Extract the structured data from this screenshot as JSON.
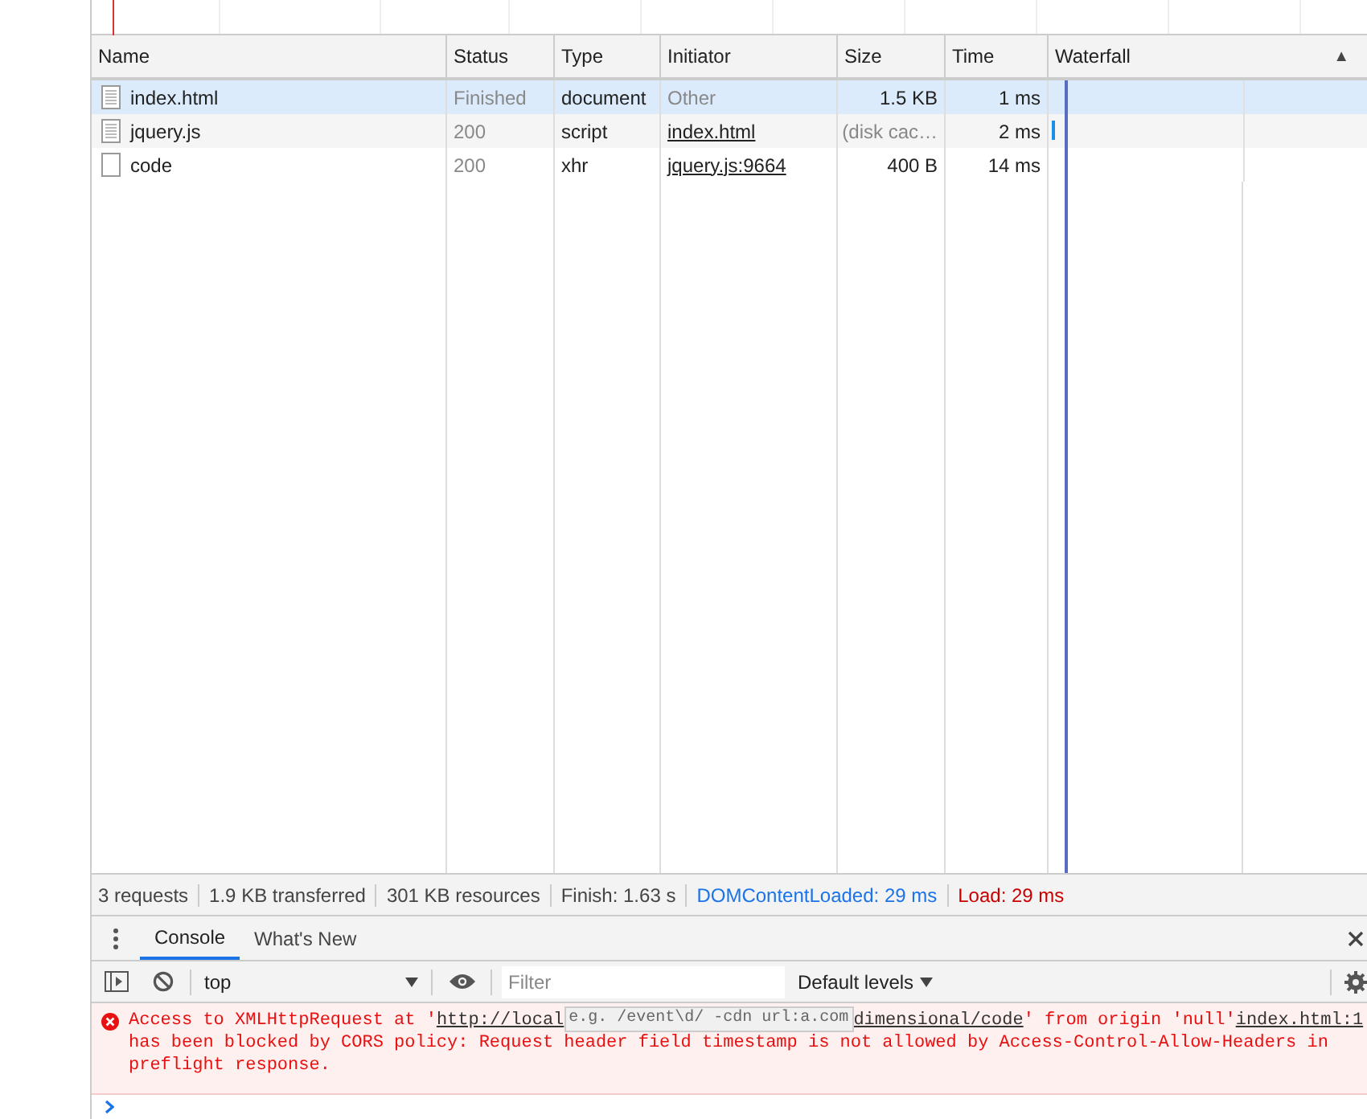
{
  "columns": [
    "Name",
    "Status",
    "Type",
    "Initiator",
    "Size",
    "Time",
    "Waterfall"
  ],
  "sort_indicator": "▲",
  "rows": [
    {
      "name": "index.html",
      "status": "Finished",
      "type": "document",
      "initiator": "Other",
      "initiator_link": false,
      "size": "1.5 KB",
      "time": "1 ms",
      "selected": true,
      "kind": "doc"
    },
    {
      "name": "jquery.js",
      "status": "200",
      "type": "script",
      "initiator": "index.html",
      "initiator_link": true,
      "size": "(disk cac…",
      "time": "2 ms",
      "selected": false,
      "kind": "doc"
    },
    {
      "name": "code",
      "status": "200",
      "type": "xhr",
      "initiator": "jquery.js:9664",
      "initiator_link": true,
      "size": "400 B",
      "time": "14 ms",
      "selected": false,
      "kind": "blank"
    }
  ],
  "summary": [
    {
      "text": "3 requests",
      "kind": "plain"
    },
    {
      "text": "1.9 KB transferred",
      "kind": "plain"
    },
    {
      "text": "301 KB resources",
      "kind": "plain"
    },
    {
      "text": "Finish: 1.63 s",
      "kind": "plain"
    },
    {
      "text": "DOMContentLoaded: 29 ms",
      "kind": "dcl"
    },
    {
      "text": "Load: 29 ms",
      "kind": "load"
    }
  ],
  "drawer_tabs": [
    {
      "label": "Console",
      "selected": true
    },
    {
      "label": "What's New",
      "selected": false
    }
  ],
  "console_toolbar": {
    "context": "top",
    "filter_placeholder": "Filter",
    "levels": "Default levels"
  },
  "tooltip": "e.g. /event\\d/ -cdn url:a.com",
  "error": {
    "before": "Access to XMLHttpRequest at '",
    "url_start": "http://local",
    "url_end": "dimensional/code",
    "after": "' from origin 'null'",
    "source": "index.html:1",
    "rest": "has been blocked by CORS policy: Request header field timestamp is not allowed by Access-Control-Allow-Headers in preflight response."
  }
}
